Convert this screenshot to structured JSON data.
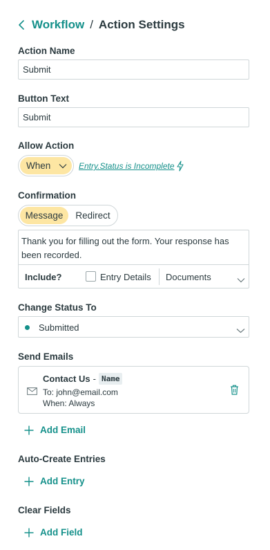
{
  "header": {
    "breadcrumb_parent": "Workflow",
    "separator": "/",
    "title": "Action Settings"
  },
  "action_name": {
    "label": "Action Name",
    "value": "Submit"
  },
  "button_text": {
    "label": "Button Text",
    "value": "Submit"
  },
  "allow_action": {
    "label": "Allow Action",
    "mode": "When",
    "condition": "Entry.Status is Incomplete"
  },
  "confirmation": {
    "label": "Confirmation",
    "tabs": [
      "Message",
      "Redirect"
    ],
    "active_tab": "Message",
    "message": "Thank you for filling out the form. Your response has been recorded.",
    "include_label": "Include?",
    "entry_details_label": "Entry Details",
    "entry_details_checked": false,
    "documents_label": "Documents"
  },
  "change_status": {
    "label": "Change Status To",
    "value": "Submitted",
    "dot_color": "#14908a"
  },
  "send_emails": {
    "label": "Send Emails",
    "emails": [
      {
        "title": "Contact Us",
        "dash": "-",
        "tag": "Name",
        "to": "To: john@email.com",
        "when": "When: Always"
      }
    ],
    "add_label": "Add Email"
  },
  "auto_create": {
    "label": "Auto-Create Entries",
    "add_label": "Add Entry"
  },
  "clear_fields": {
    "label": "Clear Fields",
    "add_label": "Add Field"
  },
  "colors": {
    "accent": "#14908a",
    "highlight": "#fde6a3",
    "border": "#cfd6d8",
    "text": "#2b3a3f"
  }
}
